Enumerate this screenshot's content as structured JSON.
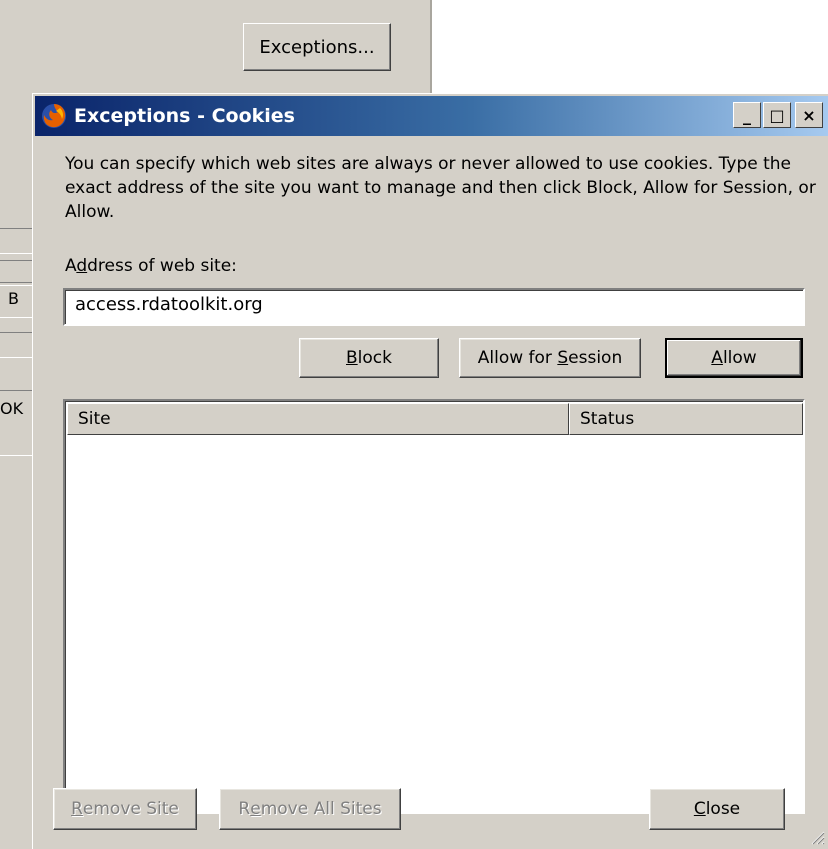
{
  "background": {
    "exceptions_button": "Exceptions...",
    "edge_labels": [
      "B",
      "OK"
    ]
  },
  "dialog": {
    "title": "Exceptions - Cookies",
    "controls": [
      "_",
      "□",
      "×"
    ],
    "description": "You can specify which web sites are always or never allowed to use cookies. Type the exact address of the site you want to manage and then click Block, Allow for Session, or Allow.",
    "address_label_pre": "A",
    "address_label_acc": "d",
    "address_label_post": "dress of web site:",
    "address_value": "access.rdatoolkit.org",
    "buttons": {
      "block_acc": "B",
      "block_rest": "lock",
      "session_pre": "Allow for ",
      "session_acc": "S",
      "session_post": "ession",
      "allow_acc": "A",
      "allow_rest": "llow",
      "remove_acc": "R",
      "remove_rest": "emove Site",
      "remove_all_pre": "R",
      "remove_all_acc": "e",
      "remove_all_post": "move All Sites",
      "close_acc": "C",
      "close_rest": "lose"
    },
    "columns": [
      "Site",
      "Status"
    ]
  },
  "icons": {
    "title_icon": "firefox-icon",
    "grip": "resize-grip-icon"
  }
}
